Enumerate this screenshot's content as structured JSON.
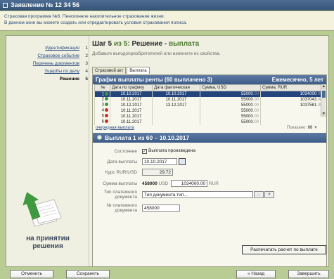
{
  "window": {
    "title": "Заявление № 12 34 56"
  },
  "info": {
    "line1": "Страховая программа №6. Пенсионное накопительное страхование жизни.",
    "line2": "В данном окне вы можете создать или отредактировать условия страхования полиса."
  },
  "steps": [
    {
      "label": "Идентификация",
      "num": "1"
    },
    {
      "label": "Страховое событие",
      "num": "2"
    },
    {
      "label": "Перечень документов",
      "num": "3"
    },
    {
      "label": "Ущербы по делу",
      "num": "4"
    },
    {
      "label": "Решение",
      "num": "5"
    }
  ],
  "caption": {
    "line1": "на принятии",
    "line2": "решения"
  },
  "header": {
    "step_prefix": "Шаг 5",
    "step_of": "из 5:",
    "step_name": "Решение",
    "dash": "-",
    "step_accent": "выплата",
    "subtitle": "Добавьте выгодоприобретателей или измените их свойства."
  },
  "tabs": [
    "Страховой акт",
    "Выплата"
  ],
  "grid": {
    "title": "График выплаты ренты (60 выплачено 3)",
    "period": "Ежемесячно, 5 лет",
    "columns": [
      "№",
      "Дата по графику",
      "Дата фактическая",
      "Сумма, USD",
      "Сумма, RUR"
    ],
    "rows": [
      {
        "n": "1",
        "status": "green",
        "plan": "10.10.2017",
        "fact": "10.10.2017",
        "usd": "55000",
        "usd_dec": ".00",
        "rur": "1034000",
        "rur_dec": ".00"
      },
      {
        "n": "2",
        "status": "green",
        "plan": "10.11.2017",
        "fact": "10.11.2017",
        "usd": "55000",
        "usd_dec": ".00",
        "rur": "1037043",
        "rur_dec": ".00"
      },
      {
        "n": "3",
        "status": "green",
        "plan": "10.12.2017",
        "fact": "13.12.2017",
        "usd": "55000",
        "usd_dec": ".00",
        "rur": "1037561",
        "rur_dec": ".00"
      },
      {
        "n": "4",
        "status": "red",
        "plan": "10.11.2017",
        "fact": "",
        "usd": "55000",
        "usd_dec": ".00",
        "rur": "",
        "rur_dec": ""
      },
      {
        "n": "5",
        "status": "red",
        "plan": "10.11.2017",
        "fact": "",
        "usd": "55000",
        "usd_dec": ".00",
        "rur": "",
        "rur_dec": ""
      },
      {
        "n": "6",
        "status": "red",
        "plan": "10.11.2017",
        "fact": "",
        "usd": "55000",
        "usd_dec": ".00",
        "rur": "",
        "rur_dec": ""
      }
    ],
    "next_link": "очередная выплата",
    "shown_label": "Показано:",
    "shown_count": "66"
  },
  "payment": {
    "title": "Выплата 1 из 60 – 10.10.2017",
    "state_label": "Состояние",
    "state_value": "Выплата произведена",
    "date_label": "Дата выплаты",
    "date_value": "10.10.2017",
    "rate_label": "Курс RUR/USD",
    "rate_value": "29.72",
    "sum_label": "Сумма выплаты",
    "sum_usd": "458000",
    "sum_usd_unit": "USD",
    "sum_rur": "1034000.00",
    "sum_rur_unit": "RUR",
    "doc_type_label_1": "Тип платежного",
    "doc_type_label_2": "документа",
    "doc_type_value": "Тип документа тип...",
    "doc_type_more": "...",
    "doc_type_clear": "×",
    "doc_no_label_1": "№ платежного",
    "doc_no_label_2": "документа",
    "doc_no_value": "458000",
    "print_label": "Распечатать расчет по выплате"
  },
  "footer": {
    "cancel": "Отменить",
    "save": "Сохранить",
    "back": "« Назад",
    "finish": "Завершить"
  },
  "colors": {
    "titlebar": "#3c5b80",
    "accent_green": "#4b7a2d",
    "selection": "#23447d",
    "page_bg": "#b9cc94"
  }
}
